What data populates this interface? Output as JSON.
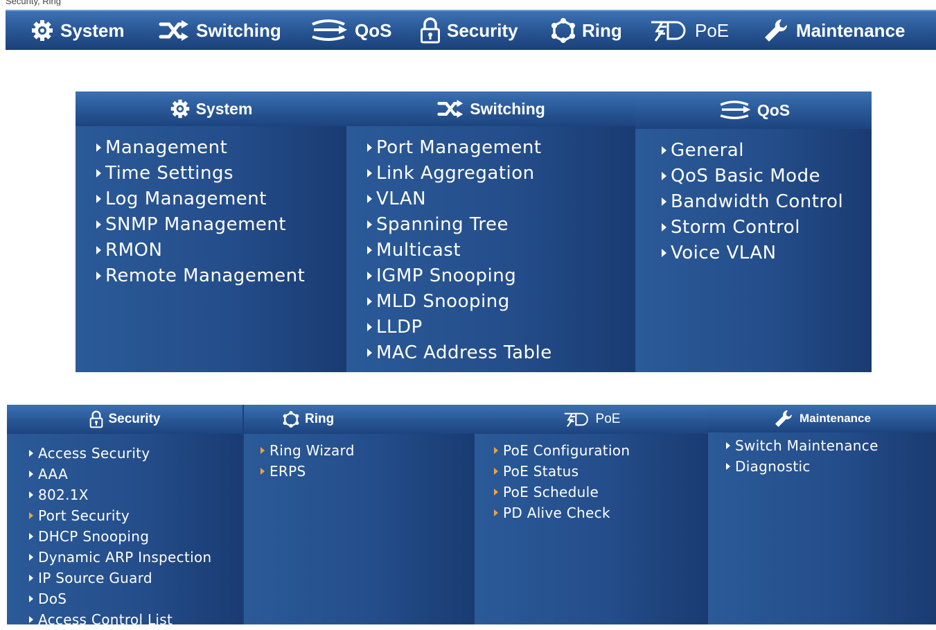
{
  "caption": "Security, Ring",
  "navbar": {
    "items": [
      {
        "label": "System",
        "icon": "gear-icon"
      },
      {
        "label": "Switching",
        "icon": "switching-icon"
      },
      {
        "label": "QoS",
        "icon": "qos-icon"
      },
      {
        "label": "Security",
        "icon": "lock-icon"
      },
      {
        "label": "Ring",
        "icon": "ring-icon"
      },
      {
        "label": "PoE",
        "icon": "poe-icon"
      },
      {
        "label": "Maintenance",
        "icon": "wrench-icon"
      }
    ]
  },
  "panel1": {
    "system": {
      "title": "System",
      "items": [
        "Management",
        "Time Settings",
        "Log Management",
        "SNMP Management",
        "RMON",
        "Remote Management"
      ]
    },
    "switching": {
      "title": "Switching",
      "items": [
        "Port Management",
        "Link Aggregation",
        "VLAN",
        "Spanning Tree",
        "Multicast",
        "IGMP Snooping",
        "MLD Snooping",
        "LLDP",
        "MAC Address Table"
      ]
    },
    "qos": {
      "title": "QoS",
      "items": [
        "General",
        "QoS Basic Mode",
        "Bandwidth Control",
        "Storm Control",
        "Voice VLAN"
      ]
    }
  },
  "panel2": {
    "security": {
      "title": "Security",
      "items": [
        "Access Security",
        "AAA",
        "802.1X",
        "Port Security",
        "DHCP Snooping",
        "Dynamic ARP Inspection",
        "IP Source Guard",
        "DoS",
        "Access Control List"
      ]
    },
    "ring": {
      "title": "Ring",
      "items": [
        "Ring Wizard",
        "ERPS"
      ]
    },
    "poe": {
      "title": "PoE",
      "items": [
        "PoE Configuration",
        "PoE Status",
        "PoE Schedule",
        "PD Alive Check"
      ]
    },
    "maintenance": {
      "title": "Maintenance",
      "items": [
        "Switch Maintenance",
        "Diagnostic"
      ]
    }
  },
  "colors": {
    "bar_top": "#3d72b5",
    "bar_bottom": "#1b4079",
    "panel_bg": "#244e8b",
    "text": "#ffffff",
    "arrow_accent": "#f0a040"
  }
}
